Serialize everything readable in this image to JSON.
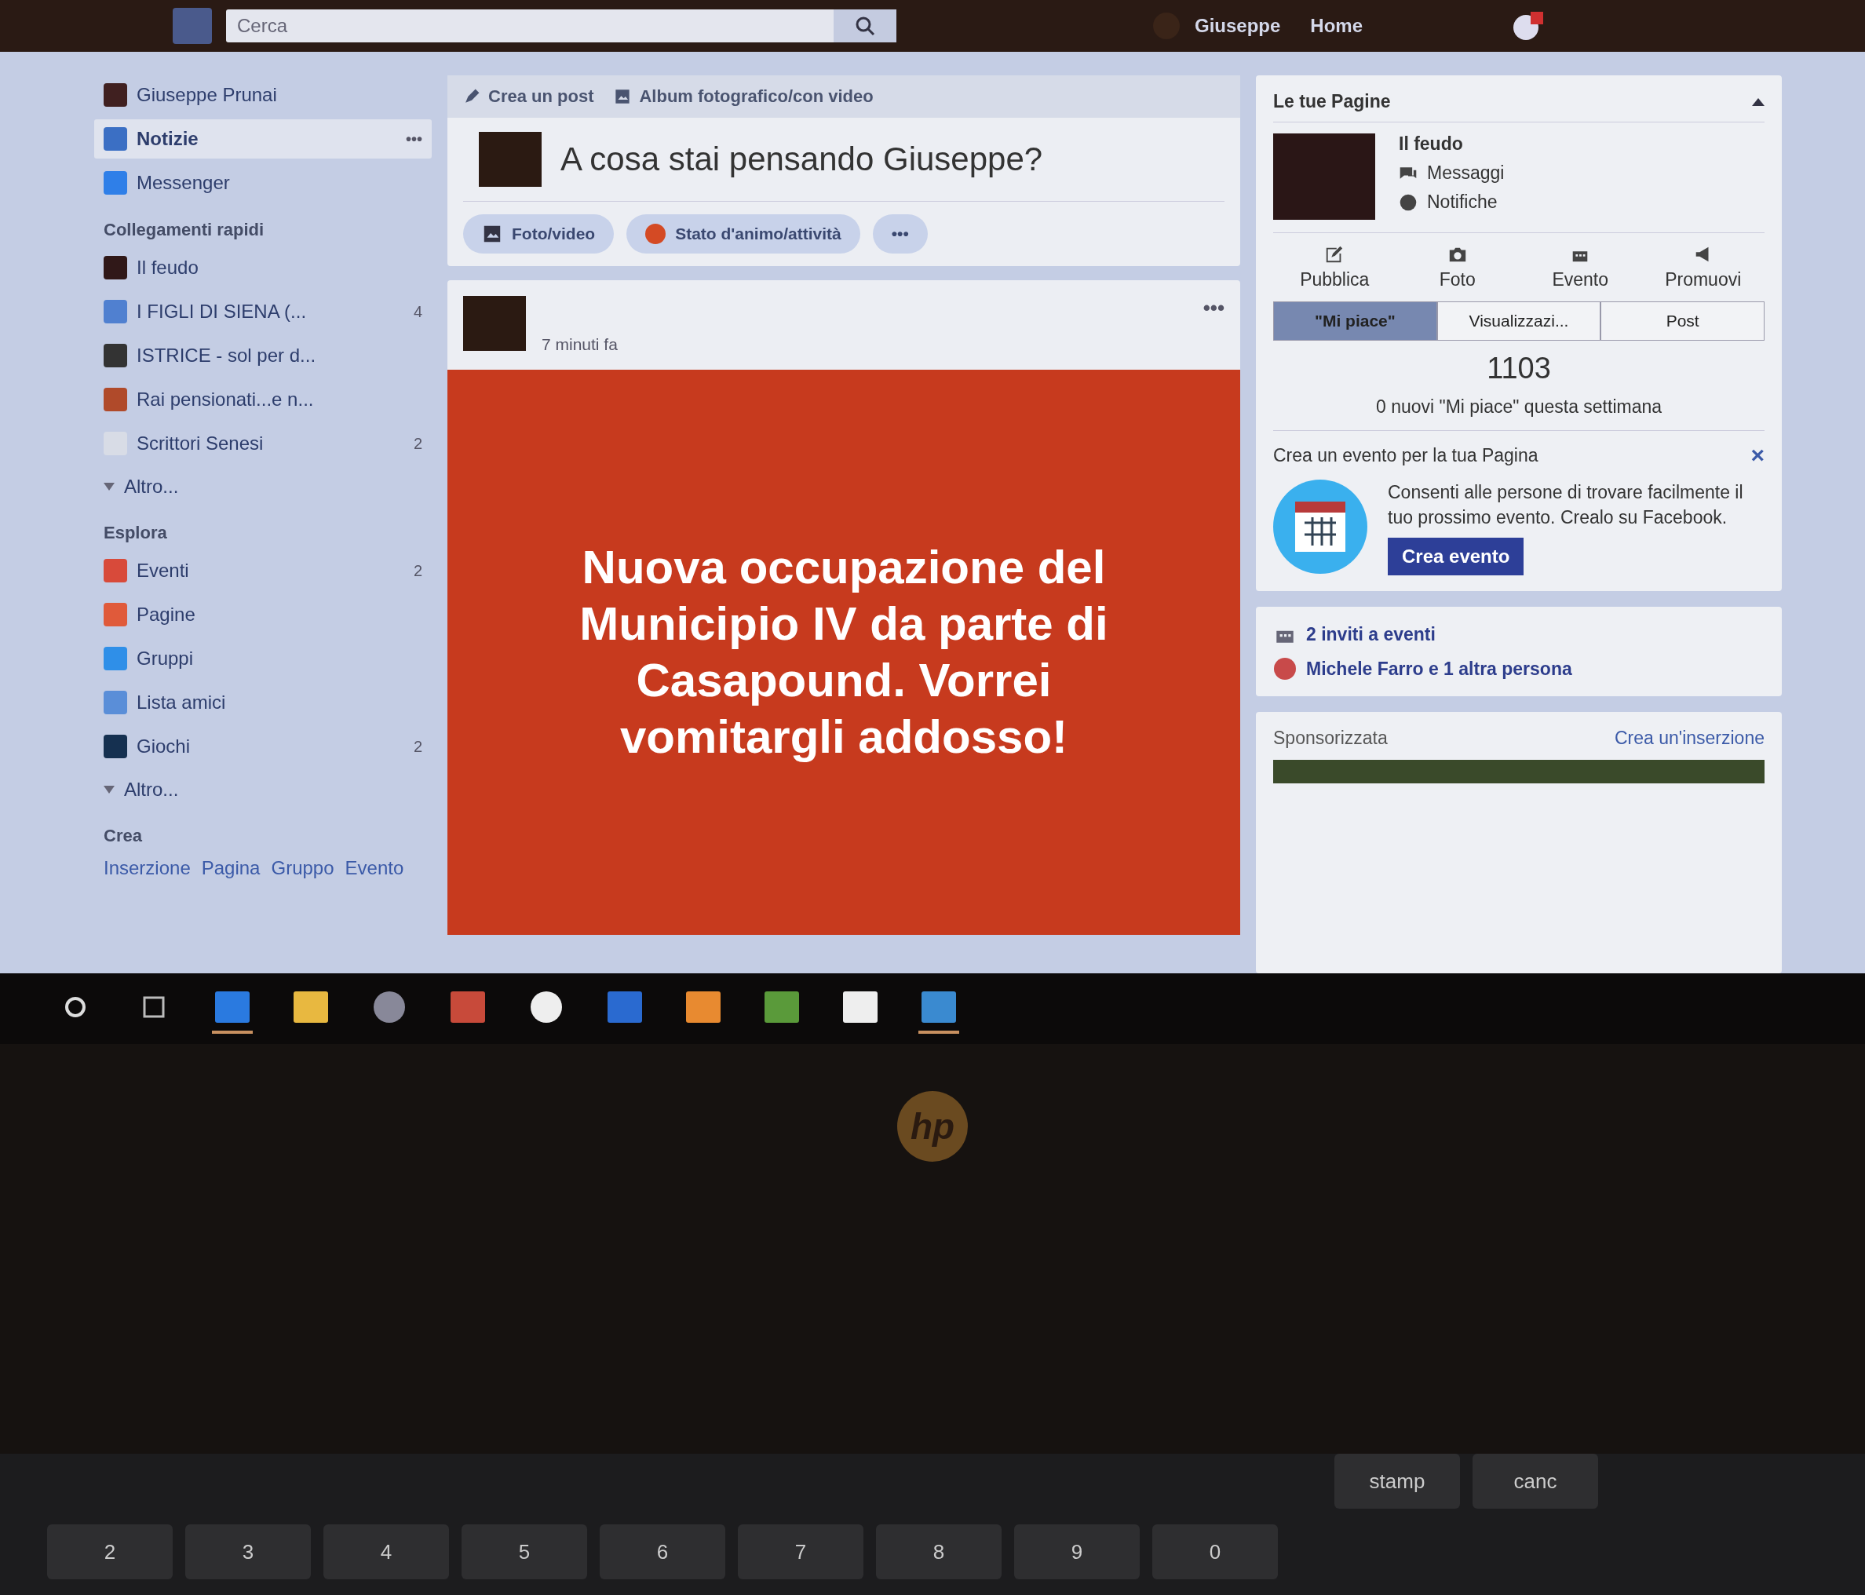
{
  "topbar": {
    "search_placeholder": "Cerca",
    "user": "Giuseppe",
    "home": "Home"
  },
  "sidebar": {
    "profile": "Giuseppe Prunai",
    "main_items": [
      {
        "label": "Notizie",
        "selected": true,
        "kind": "news",
        "more": "•••"
      },
      {
        "label": "Messenger",
        "selected": false,
        "kind": "messenger"
      }
    ],
    "sections": [
      {
        "title": "Collegamenti rapidi",
        "items": [
          {
            "label": "Il feudo",
            "kind": "page"
          },
          {
            "label": "I FIGLI DI SIENA (...",
            "count": "4",
            "kind": "group"
          },
          {
            "label": "ISTRICE - sol per d...",
            "kind": "horse"
          },
          {
            "label": "Rai pensionati...e n...",
            "kind": "hand"
          },
          {
            "label": "Scrittori Senesi",
            "count": "2",
            "kind": "book"
          },
          {
            "label": "Altro...",
            "kind": "more"
          }
        ]
      },
      {
        "title": "Esplora",
        "items": [
          {
            "label": "Eventi",
            "count": "2",
            "kind": "calendar"
          },
          {
            "label": "Pagine",
            "kind": "flag"
          },
          {
            "label": "Gruppi",
            "kind": "groups"
          },
          {
            "label": "Lista amici",
            "kind": "friends"
          },
          {
            "label": "Giochi",
            "count": "2",
            "kind": "games"
          },
          {
            "label": "Altro...",
            "kind": "more"
          }
        ]
      }
    ],
    "create": {
      "title": "Crea",
      "links": [
        "Inserzione",
        "Pagina",
        "Gruppo",
        "Evento"
      ]
    }
  },
  "composer": {
    "tabs": [
      {
        "label": "Crea un post",
        "kind": "pencil"
      },
      {
        "label": "Album fotografico/con video",
        "kind": "album"
      }
    ],
    "prompt": "A cosa stai pensando Giuseppe?",
    "actions": [
      {
        "label": "Foto/video",
        "kind": "photo"
      },
      {
        "label": "Stato d'animo/attività",
        "kind": "mood"
      },
      {
        "label": "•••",
        "kind": "more"
      }
    ]
  },
  "post": {
    "time": "7 minuti fa",
    "menu": "•••",
    "text": "Nuova occupazione del Municipio IV da parte di Casapound. Vorrei vomitargli addosso!"
  },
  "pages": {
    "title": "Le tue Pagine",
    "name": "Il feudo",
    "links": [
      {
        "label": "Messaggi",
        "kind": "messages"
      },
      {
        "label": "Notifiche",
        "kind": "globe"
      }
    ],
    "actions": [
      {
        "label": "Pubblica",
        "kind": "edit"
      },
      {
        "label": "Foto",
        "kind": "camera"
      },
      {
        "label": "Evento",
        "kind": "calendar"
      },
      {
        "label": "Promuovi",
        "kind": "megaphone"
      }
    ],
    "stat_tabs": [
      {
        "label": "\"Mi piace\"",
        "selected": true
      },
      {
        "label": "Visualizzazi...",
        "selected": false
      },
      {
        "label": "Post",
        "selected": false
      }
    ],
    "count": "1103",
    "note": "0 nuovi \"Mi piace\" questa settimana"
  },
  "event_promo": {
    "title": "Crea un evento per la tua Pagina",
    "close": "×",
    "text": "Consenti alle persone di trovare facilmente il tuo prossimo evento. Crealo su Facebook.",
    "button": "Crea evento"
  },
  "invites": {
    "title": "2 inviti a eventi",
    "people": "Michele Farro e 1 altra persona"
  },
  "sponsored": {
    "title": "Sponsorizzata",
    "link": "Crea un'inserzione"
  },
  "taskbar": [
    {
      "kind": "cortana",
      "selected": false
    },
    {
      "kind": "taskview",
      "selected": false
    },
    {
      "kind": "edge",
      "selected": true
    },
    {
      "kind": "folder",
      "selected": false
    },
    {
      "kind": "webcam",
      "selected": false
    },
    {
      "kind": "photos",
      "selected": false
    },
    {
      "kind": "hp",
      "selected": false
    },
    {
      "kind": "word",
      "selected": false
    },
    {
      "kind": "outlook",
      "selected": false
    },
    {
      "kind": "video",
      "selected": false
    },
    {
      "kind": "store",
      "selected": false
    },
    {
      "kind": "image",
      "selected": true
    }
  ],
  "laptop": {
    "logo": "hp",
    "function_keys": [
      "stamp",
      "canc"
    ],
    "number_keys": [
      "2",
      "3",
      "4",
      "5",
      "6",
      "7",
      "8",
      "9",
      "0"
    ]
  }
}
